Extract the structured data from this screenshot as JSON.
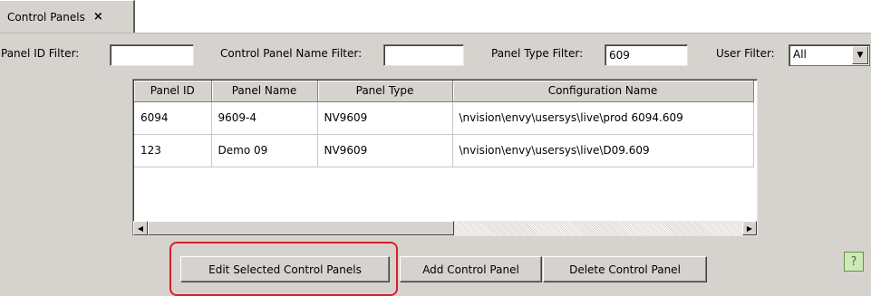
{
  "tab": {
    "label": "Control Panels",
    "close_glyph": "×"
  },
  "filters": {
    "panel_id_label": "Panel ID Filter:",
    "panel_id_value": "",
    "panel_name_label": "Control Panel Name Filter:",
    "panel_name_value": "",
    "panel_type_label": "Panel Type Filter:",
    "panel_type_value": "609",
    "user_label": "User Filter:",
    "user_value": "All"
  },
  "table": {
    "columns": [
      "Panel ID",
      "Panel Name",
      "Panel Type",
      "Configuration Name"
    ],
    "rows": [
      [
        "6094",
        "9609-4",
        "NV9609",
        "\\nvision\\envy\\usersys\\live\\prod 6094.609"
      ],
      [
        "123",
        "Demo 09",
        "NV9609",
        "\\nvision\\envy\\usersys\\live\\D09.609"
      ]
    ]
  },
  "buttons": {
    "edit": "Edit Selected Control Panels",
    "add": "Add Control Panel",
    "delete": "Delete Control Panel"
  },
  "icons": {
    "help": "help-icon",
    "help_glyph": "?"
  },
  "colors": {
    "panel_bg": "#d6d3ce",
    "highlight": "#d6202a",
    "help_bg": "#cfe8b8"
  }
}
